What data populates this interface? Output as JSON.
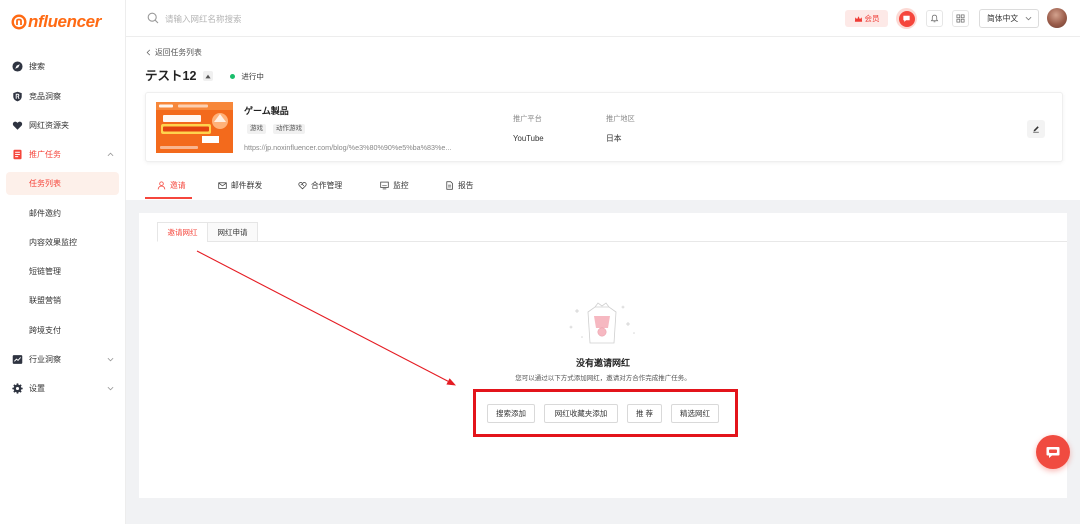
{
  "theme": {
    "accent": "#f5463c",
    "logo_color": "#ff6a13",
    "status_running": "#19be6b",
    "annotation": "#e3141b"
  },
  "logo": {
    "text": "nfluencer",
    "icon": "logo-swirl-icon"
  },
  "header": {
    "search_placeholder": "请输入网红名称搜索",
    "vip_label": "会员",
    "language": "简体中文"
  },
  "sidebar": {
    "items": [
      {
        "label": "搜索",
        "icon": "compass-icon"
      },
      {
        "label": "竞品洞察",
        "icon": "shield-icon"
      },
      {
        "label": "网红资源夹",
        "icon": "heart-icon"
      },
      {
        "label": "推广任务",
        "icon": "task-icon",
        "expanded": true
      },
      {
        "label": "任务列表",
        "active": true
      },
      {
        "label": "邮件邀约"
      },
      {
        "label": "内容效果监控"
      },
      {
        "label": "短链管理"
      },
      {
        "label": "联盟营销"
      },
      {
        "label": "跨境支付"
      },
      {
        "label": "行业洞察",
        "icon": "chart-icon",
        "expanded": false
      },
      {
        "label": "设置",
        "icon": "gear-icon",
        "expanded": false
      }
    ]
  },
  "breadcrumb": {
    "back_label": "返回任务列表"
  },
  "task": {
    "title": "テスト12",
    "status": "进行中"
  },
  "product": {
    "name": "ゲーム製品",
    "tags": [
      "游戏",
      "动作游戏"
    ],
    "url": "https://jp.noxinfluencer.com/blog/%e3%80%90%e5%ba%83%e...",
    "platform_label": "推广平台",
    "platform": "YouTube",
    "region_label": "推广地区",
    "region": "日本"
  },
  "tabs": [
    {
      "label": "邀请",
      "icon": "person-icon",
      "active": true
    },
    {
      "label": "邮件群发",
      "icon": "mail-icon"
    },
    {
      "label": "合作管理",
      "icon": "cooperation-icon"
    },
    {
      "label": "监控",
      "icon": "monitor-icon"
    },
    {
      "label": "报告",
      "icon": "report-icon"
    }
  ],
  "sub_tabs": [
    {
      "label": "邀请网红",
      "active": true
    },
    {
      "label": "网红申请"
    }
  ],
  "empty_state": {
    "title": "没有邀请网红",
    "description": "您可以通过以下方式添加网红，邀请对方合作完成推广任务。",
    "actions": [
      "搜索添加",
      "网红收藏夹添加",
      "推 荐",
      "精选网红"
    ]
  }
}
